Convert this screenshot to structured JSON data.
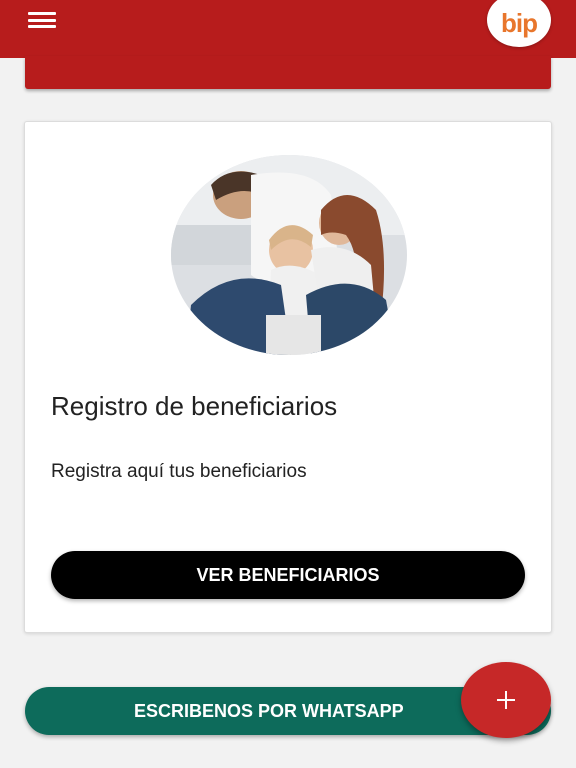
{
  "header": {
    "logo_text": "bip",
    "menu_icon": "hamburger-menu-icon",
    "color": "#b71c1c"
  },
  "card": {
    "image": "family-photo",
    "title": "Registro de beneficiarios",
    "description": "Registra aquí tus beneficiarios",
    "button_label": "VER BENEFICIARIOS"
  },
  "whatsapp": {
    "label": "ESCRIBENOS POR WHATSAPP",
    "color": "#0d6b5b"
  },
  "fab": {
    "icon": "plus-icon",
    "color": "#c62828"
  }
}
